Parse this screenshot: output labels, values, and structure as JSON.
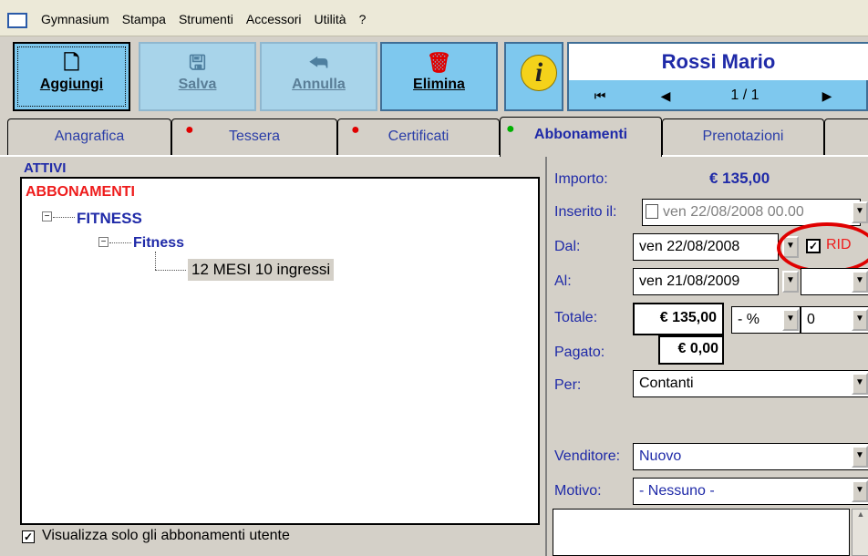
{
  "menu": {
    "items": [
      "Gymnasium",
      "Stampa",
      "Strumenti",
      "Accessori",
      "Utilità",
      "?"
    ]
  },
  "toolbar": {
    "aggiungi": "Aggiungi",
    "salva": "Salva",
    "annulla": "Annulla",
    "elimina": "Elimina",
    "info_glyph": "i"
  },
  "member": {
    "name": "Rossi Mario",
    "counter": "1 / 1",
    "nav_first": "⏮",
    "nav_prev": "◀",
    "nav_next": "▶"
  },
  "tabs": [
    {
      "label": "Anagrafica"
    },
    {
      "label": "Tessera"
    },
    {
      "label": "Certificati"
    },
    {
      "label": "Abbonamenti"
    },
    {
      "label": "Prenotazioni"
    }
  ],
  "left": {
    "attivi": "ATTIVI",
    "tree_root": "ABBONAMENTI",
    "tree_group": "FITNESS",
    "tree_sub": "Fitness",
    "tree_item": "12 MESI 10 ingressi",
    "only_user_label": "Visualizza solo gli abbonamenti utente",
    "only_user_checked": true
  },
  "form": {
    "importo_label": "Importo:",
    "importo_value": "€ 135,00",
    "inserito_label": "Inserito il:",
    "inserito_value": "ven  22/08/2008 00.00",
    "dal_label": "Dal:",
    "dal_value": "ven  22/08/2008",
    "rid_label": "RID",
    "rid_checked": true,
    "al_label": "Al:",
    "al_value": "ven  21/08/2009",
    "totale_label": "Totale:",
    "totale_value": "€ 135,00",
    "sconto_type": "- %",
    "sconto_value": "0",
    "pagato_label": "Pagato:",
    "pagato_value": "€ 0,00",
    "per_label": "Per:",
    "per_value": "Contanti",
    "venditore_label": "Venditore:",
    "venditore_value": "Nuovo",
    "motivo_label": "Motivo:",
    "motivo_value": "- Nessuno -"
  },
  "colors": {
    "toolbar_blue": "#7ec8ee",
    "label_blue": "#1f2aa8",
    "alert_red": "#ee1c1c",
    "active_dot": "#00b000"
  }
}
